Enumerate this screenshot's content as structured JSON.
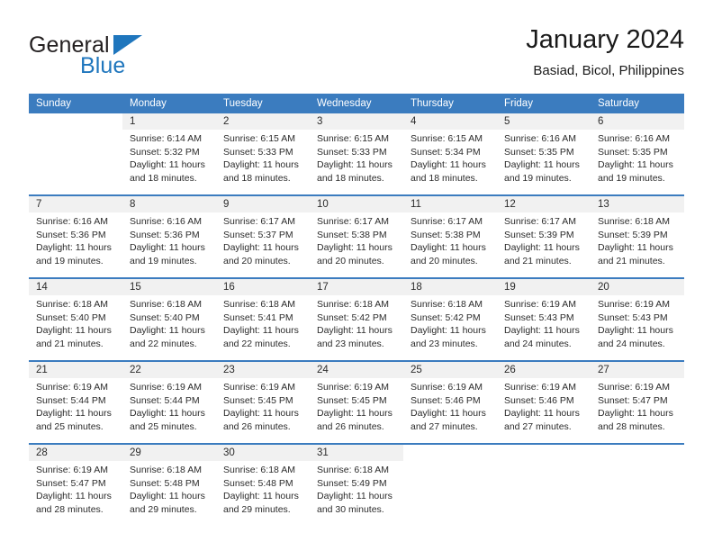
{
  "brand": {
    "name_part1": "General",
    "name_part2": "Blue",
    "color_primary": "#1f76bd",
    "color_text": "#231f20"
  },
  "header": {
    "title": "January 2024",
    "subtitle": "Basiad, Bicol, Philippines"
  },
  "theme": {
    "header_band": "#3b7cbf",
    "day_band": "#f1f1f1",
    "text": "#2b2b2b"
  },
  "weekdays": [
    "Sunday",
    "Monday",
    "Tuesday",
    "Wednesday",
    "Thursday",
    "Friday",
    "Saturday"
  ],
  "labels": {
    "sunrise_prefix": "Sunrise:",
    "sunset_prefix": "Sunset:",
    "daylight_prefix": "Daylight:"
  },
  "weeks": [
    [
      {
        "day": "",
        "sunrise": "",
        "sunset": "",
        "daylight": ""
      },
      {
        "day": "1",
        "sunrise": "Sunrise: 6:14 AM",
        "sunset": "Sunset: 5:32 PM",
        "daylight": "Daylight: 11 hours and 18 minutes."
      },
      {
        "day": "2",
        "sunrise": "Sunrise: 6:15 AM",
        "sunset": "Sunset: 5:33 PM",
        "daylight": "Daylight: 11 hours and 18 minutes."
      },
      {
        "day": "3",
        "sunrise": "Sunrise: 6:15 AM",
        "sunset": "Sunset: 5:33 PM",
        "daylight": "Daylight: 11 hours and 18 minutes."
      },
      {
        "day": "4",
        "sunrise": "Sunrise: 6:15 AM",
        "sunset": "Sunset: 5:34 PM",
        "daylight": "Daylight: 11 hours and 18 minutes."
      },
      {
        "day": "5",
        "sunrise": "Sunrise: 6:16 AM",
        "sunset": "Sunset: 5:35 PM",
        "daylight": "Daylight: 11 hours and 19 minutes."
      },
      {
        "day": "6",
        "sunrise": "Sunrise: 6:16 AM",
        "sunset": "Sunset: 5:35 PM",
        "daylight": "Daylight: 11 hours and 19 minutes."
      }
    ],
    [
      {
        "day": "7",
        "sunrise": "Sunrise: 6:16 AM",
        "sunset": "Sunset: 5:36 PM",
        "daylight": "Daylight: 11 hours and 19 minutes."
      },
      {
        "day": "8",
        "sunrise": "Sunrise: 6:16 AM",
        "sunset": "Sunset: 5:36 PM",
        "daylight": "Daylight: 11 hours and 19 minutes."
      },
      {
        "day": "9",
        "sunrise": "Sunrise: 6:17 AM",
        "sunset": "Sunset: 5:37 PM",
        "daylight": "Daylight: 11 hours and 20 minutes."
      },
      {
        "day": "10",
        "sunrise": "Sunrise: 6:17 AM",
        "sunset": "Sunset: 5:38 PM",
        "daylight": "Daylight: 11 hours and 20 minutes."
      },
      {
        "day": "11",
        "sunrise": "Sunrise: 6:17 AM",
        "sunset": "Sunset: 5:38 PM",
        "daylight": "Daylight: 11 hours and 20 minutes."
      },
      {
        "day": "12",
        "sunrise": "Sunrise: 6:17 AM",
        "sunset": "Sunset: 5:39 PM",
        "daylight": "Daylight: 11 hours and 21 minutes."
      },
      {
        "day": "13",
        "sunrise": "Sunrise: 6:18 AM",
        "sunset": "Sunset: 5:39 PM",
        "daylight": "Daylight: 11 hours and 21 minutes."
      }
    ],
    [
      {
        "day": "14",
        "sunrise": "Sunrise: 6:18 AM",
        "sunset": "Sunset: 5:40 PM",
        "daylight": "Daylight: 11 hours and 21 minutes."
      },
      {
        "day": "15",
        "sunrise": "Sunrise: 6:18 AM",
        "sunset": "Sunset: 5:40 PM",
        "daylight": "Daylight: 11 hours and 22 minutes."
      },
      {
        "day": "16",
        "sunrise": "Sunrise: 6:18 AM",
        "sunset": "Sunset: 5:41 PM",
        "daylight": "Daylight: 11 hours and 22 minutes."
      },
      {
        "day": "17",
        "sunrise": "Sunrise: 6:18 AM",
        "sunset": "Sunset: 5:42 PM",
        "daylight": "Daylight: 11 hours and 23 minutes."
      },
      {
        "day": "18",
        "sunrise": "Sunrise: 6:18 AM",
        "sunset": "Sunset: 5:42 PM",
        "daylight": "Daylight: 11 hours and 23 minutes."
      },
      {
        "day": "19",
        "sunrise": "Sunrise: 6:19 AM",
        "sunset": "Sunset: 5:43 PM",
        "daylight": "Daylight: 11 hours and 24 minutes."
      },
      {
        "day": "20",
        "sunrise": "Sunrise: 6:19 AM",
        "sunset": "Sunset: 5:43 PM",
        "daylight": "Daylight: 11 hours and 24 minutes."
      }
    ],
    [
      {
        "day": "21",
        "sunrise": "Sunrise: 6:19 AM",
        "sunset": "Sunset: 5:44 PM",
        "daylight": "Daylight: 11 hours and 25 minutes."
      },
      {
        "day": "22",
        "sunrise": "Sunrise: 6:19 AM",
        "sunset": "Sunset: 5:44 PM",
        "daylight": "Daylight: 11 hours and 25 minutes."
      },
      {
        "day": "23",
        "sunrise": "Sunrise: 6:19 AM",
        "sunset": "Sunset: 5:45 PM",
        "daylight": "Daylight: 11 hours and 26 minutes."
      },
      {
        "day": "24",
        "sunrise": "Sunrise: 6:19 AM",
        "sunset": "Sunset: 5:45 PM",
        "daylight": "Daylight: 11 hours and 26 minutes."
      },
      {
        "day": "25",
        "sunrise": "Sunrise: 6:19 AM",
        "sunset": "Sunset: 5:46 PM",
        "daylight": "Daylight: 11 hours and 27 minutes."
      },
      {
        "day": "26",
        "sunrise": "Sunrise: 6:19 AM",
        "sunset": "Sunset: 5:46 PM",
        "daylight": "Daylight: 11 hours and 27 minutes."
      },
      {
        "day": "27",
        "sunrise": "Sunrise: 6:19 AM",
        "sunset": "Sunset: 5:47 PM",
        "daylight": "Daylight: 11 hours and 28 minutes."
      }
    ],
    [
      {
        "day": "28",
        "sunrise": "Sunrise: 6:19 AM",
        "sunset": "Sunset: 5:47 PM",
        "daylight": "Daylight: 11 hours and 28 minutes."
      },
      {
        "day": "29",
        "sunrise": "Sunrise: 6:18 AM",
        "sunset": "Sunset: 5:48 PM",
        "daylight": "Daylight: 11 hours and 29 minutes."
      },
      {
        "day": "30",
        "sunrise": "Sunrise: 6:18 AM",
        "sunset": "Sunset: 5:48 PM",
        "daylight": "Daylight: 11 hours and 29 minutes."
      },
      {
        "day": "31",
        "sunrise": "Sunrise: 6:18 AM",
        "sunset": "Sunset: 5:49 PM",
        "daylight": "Daylight: 11 hours and 30 minutes."
      },
      {
        "day": "",
        "sunrise": "",
        "sunset": "",
        "daylight": ""
      },
      {
        "day": "",
        "sunrise": "",
        "sunset": "",
        "daylight": ""
      },
      {
        "day": "",
        "sunrise": "",
        "sunset": "",
        "daylight": ""
      }
    ]
  ]
}
